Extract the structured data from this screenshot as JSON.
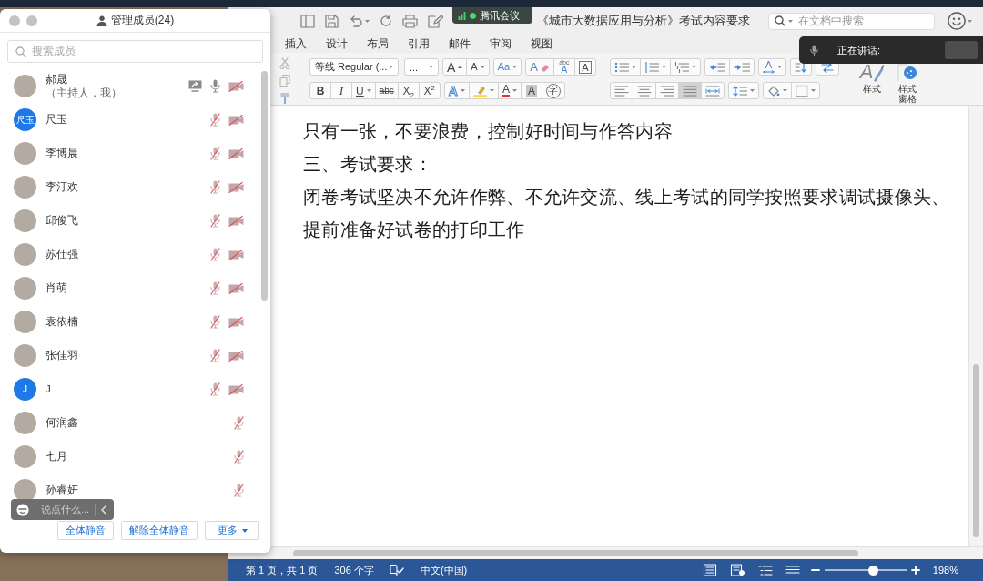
{
  "participants_panel": {
    "title": "管理成员(24)",
    "search": {
      "placeholder": "搜索成员"
    },
    "members": [
      {
        "name": "郝晟",
        "note": "（主持人，我）",
        "avatar": {
          "kind": "photo"
        },
        "sharing": true,
        "mic_muted": false,
        "camera_off": true
      },
      {
        "name": "尺玉",
        "avatar": {
          "kind": "initials",
          "text": "尺玉"
        },
        "sharing": false,
        "mic_muted": true,
        "camera_off": true
      },
      {
        "name": "李博晨",
        "avatar": {
          "kind": "photo"
        },
        "sharing": false,
        "mic_muted": true,
        "camera_off": true
      },
      {
        "name": "李汀欢",
        "avatar": {
          "kind": "photo"
        },
        "sharing": false,
        "mic_muted": true,
        "camera_off": true
      },
      {
        "name": "邱俊飞",
        "avatar": {
          "kind": "photo"
        },
        "sharing": false,
        "mic_muted": true,
        "camera_off": true
      },
      {
        "name": "苏仕强",
        "avatar": {
          "kind": "photo"
        },
        "sharing": false,
        "mic_muted": true,
        "camera_off": true
      },
      {
        "name": "肖萌",
        "avatar": {
          "kind": "photo"
        },
        "sharing": false,
        "mic_muted": true,
        "camera_off": true
      },
      {
        "name": "袁依楠",
        "avatar": {
          "kind": "photo"
        },
        "sharing": false,
        "mic_muted": true,
        "camera_off": true
      },
      {
        "name": "张佳羽",
        "avatar": {
          "kind": "photo"
        },
        "sharing": false,
        "mic_muted": true,
        "camera_off": true
      },
      {
        "name": "J",
        "avatar": {
          "kind": "initials",
          "text": "J"
        },
        "sharing": false,
        "mic_muted": true,
        "camera_off": true
      },
      {
        "name": "何润鑫",
        "avatar": {
          "kind": "photo"
        },
        "sharing": false,
        "mic_muted": true,
        "camera_off": false
      },
      {
        "name": "七月",
        "avatar": {
          "kind": "photo"
        },
        "sharing": false,
        "mic_muted": true,
        "camera_off": false
      },
      {
        "name": "孙睿妍",
        "avatar": {
          "kind": "photo"
        },
        "sharing": false,
        "mic_muted": true,
        "camera_off": false
      }
    ],
    "chat_box": {
      "placeholder": "说点什么..."
    },
    "buttons": [
      {
        "label": "全体静音",
        "dropdown": false
      },
      {
        "label": "解除全体静音",
        "dropdown": false
      },
      {
        "label": "更多",
        "dropdown": true
      }
    ]
  },
  "meeting_badge": {
    "title": "腾讯会议"
  },
  "word": {
    "title": "《城市大数据应用与分析》考试内容要求",
    "search": {
      "placeholder": "在文档中搜索"
    },
    "tabs": [
      "插入",
      "设计",
      "布局",
      "引用",
      "邮件",
      "审阅",
      "视图"
    ],
    "ribbon": {
      "font_name": "等线 Regular (...",
      "font_size": "...",
      "font_top": [
        [
          {
            "kind": "grow",
            "text": "A",
            "dropdown": false
          },
          {
            "kind": "shrink",
            "text": "A",
            "dropdown": false
          }
        ],
        [
          {
            "kind": "case",
            "text": "Aa",
            "dropdown": true
          }
        ],
        [
          {
            "kind": "clear",
            "text": "A",
            "dropdown": false
          },
          {
            "kind": "phonetic",
            "text": "abc",
            "base": "A",
            "dropdown": false
          },
          {
            "kind": "border",
            "text": "A",
            "dropdown": false
          }
        ]
      ],
      "font_bottom": [
        [
          {
            "kind": "bold",
            "text": "B",
            "dropdown": false
          },
          {
            "kind": "italic",
            "text": "I",
            "dropdown": false
          },
          {
            "kind": "underline",
            "text": "U",
            "dropdown": true
          },
          {
            "kind": "strike",
            "text": "abc",
            "dropdown": false
          },
          {
            "kind": "subscript",
            "text": "X$_{2}$",
            "dropdown": false
          },
          {
            "kind": "superscript",
            "text": "X$^{2}$",
            "dropdown": false
          }
        ],
        [
          {
            "kind": "effects",
            "text": "A",
            "dropdown": true
          },
          {
            "kind": "highlight",
            "dropdown": true
          },
          {
            "kind": "color",
            "text": "A",
            "dropdown": true
          },
          {
            "kind": "shade",
            "text": "A",
            "dropdown": false
          },
          {
            "kind": "enclose",
            "text": "字",
            "dropdown": false
          }
        ]
      ],
      "paragraph_top": [
        [
          {
            "kind": "bullets",
            "dropdown": true
          },
          {
            "kind": "numbering",
            "dropdown": true
          },
          {
            "kind": "multilevel",
            "dropdown": true
          }
        ],
        [
          {
            "kind": "outdent",
            "dropdown": false
          },
          {
            "kind": "indent",
            "dropdown": false
          }
        ],
        [
          {
            "kind": "asian",
            "text": "A",
            "dropdown": true
          }
        ],
        [
          {
            "kind": "sort",
            "dropdown": false
          }
        ],
        [
          {
            "kind": "marks",
            "dropdown": false
          }
        ]
      ],
      "paragraph_bottom": [
        [
          {
            "kind": "left",
            "dropdown": false,
            "selected": false
          },
          {
            "kind": "center",
            "dropdown": false,
            "selected": false
          },
          {
            "kind": "right",
            "dropdown": false,
            "selected": false
          },
          {
            "kind": "justify",
            "dropdown": false,
            "selected": true
          },
          {
            "kind": "distributed",
            "dropdown": false,
            "selected": false
          }
        ],
        [
          {
            "kind": "line_spacing",
            "dropdown": true
          }
        ],
        [
          {
            "kind": "fill",
            "dropdown": true
          },
          {
            "kind": "borders",
            "dropdown": true
          }
        ]
      ],
      "styles": [
        {
          "kind": "styles",
          "glyph": "A",
          "label": "样式"
        },
        {
          "kind": "pane",
          "label": "样式窗格"
        }
      ]
    },
    "document": {
      "paragraphs": [
        "只有一张，不要浪费，控制好时间与作答内容",
        "三、考试要求：",
        "闭卷考试坚决不允许作弊、不允许交流、线上考试的同学按照要求调试摄像头、提前准备好试卷的打印工作"
      ]
    },
    "status_bar": {
      "page": "第 1 页，共 1 页",
      "words": "306 个字",
      "language": "中文(中国)",
      "zoom": {
        "level": 0.61,
        "reading": "198%"
      }
    }
  },
  "speaking_indicator": {
    "label": "正在讲话:"
  }
}
